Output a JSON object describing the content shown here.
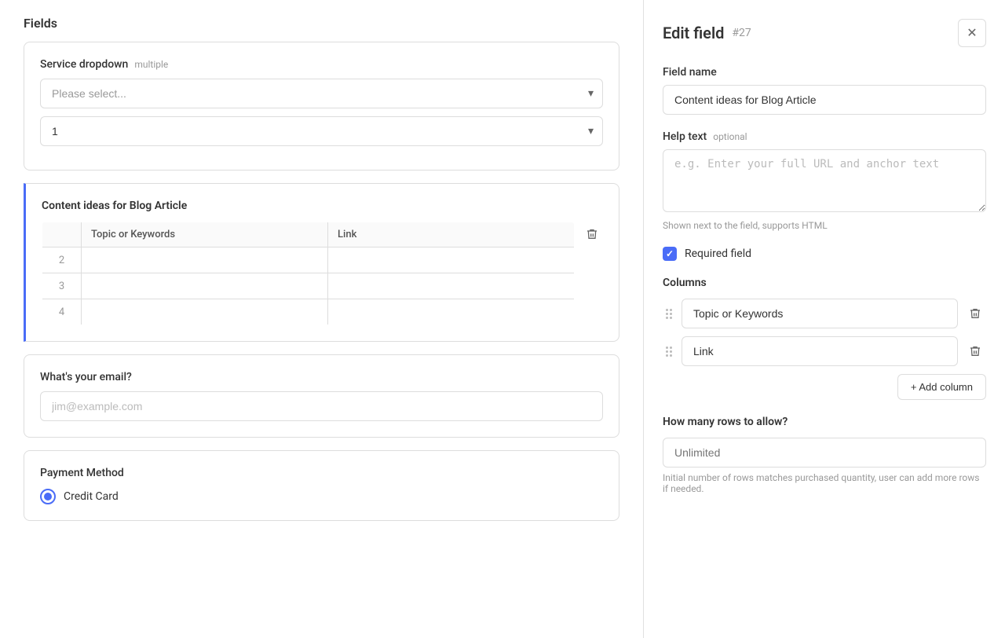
{
  "left": {
    "fields_title": "Fields",
    "service_dropdown": {
      "label": "Service dropdown",
      "tag": "multiple",
      "placeholder": "Please select...",
      "quantity_value": "1"
    },
    "table_field": {
      "title": "Content ideas for Blog Article",
      "columns": [
        "",
        "Topic or Keywords",
        "Link"
      ],
      "rows": [
        {
          "num": "2",
          "topic": "",
          "link": ""
        },
        {
          "num": "3",
          "topic": "",
          "link": ""
        },
        {
          "num": "4",
          "topic": "",
          "link": ""
        }
      ]
    },
    "email": {
      "label": "What's your email?",
      "placeholder": "jim@example.com"
    },
    "payment": {
      "label": "Payment Method",
      "options": [
        "Credit Card"
      ]
    }
  },
  "right": {
    "title": "Edit field",
    "field_number": "#27",
    "field_name_label": "Field name",
    "field_name_value": "Content ideas for Blog Article",
    "help_text_label": "Help text",
    "help_text_optional": "optional",
    "help_text_placeholder": "e.g. Enter your full URL and anchor text",
    "help_note": "Shown next to the field, supports HTML",
    "required_label": "Required field",
    "columns_label": "Columns",
    "column1_value": "Topic or Keywords",
    "column2_value": "Link",
    "add_column_label": "+ Add column",
    "rows_label": "How many rows to allow?",
    "rows_placeholder": "Unlimited",
    "rows_note": "Initial number of rows matches purchased quantity, user can add more rows if needed."
  }
}
